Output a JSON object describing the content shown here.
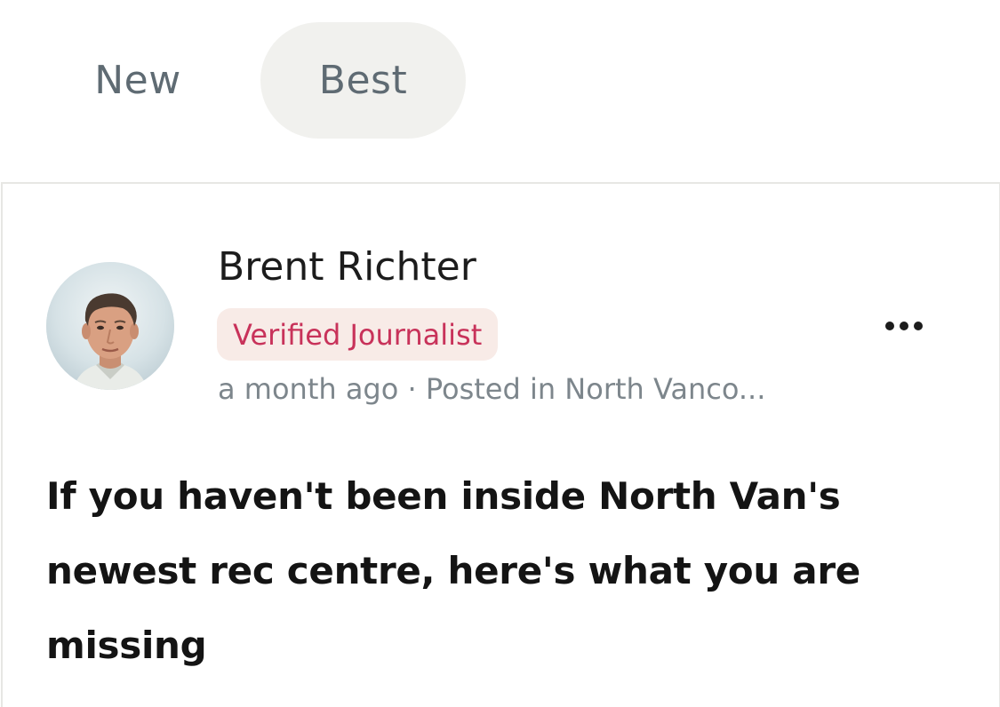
{
  "tabs": {
    "new_label": "New",
    "best_label": "Best",
    "selected": "Best"
  },
  "post": {
    "author_name": "Brent Richter",
    "badge": "Verified Journalist",
    "meta": "a month ago · Posted in North Vanco...",
    "headline": "If you haven't been inside North Van's newest rec centre, here's what you are missing"
  },
  "icons": {
    "avatar": "author-photo",
    "more": "more-options-icon"
  },
  "colors": {
    "tab_selected_bg": "#f1f1ee",
    "tab_text": "#5f6b73",
    "badge_bg": "#f8ebe7",
    "badge_text": "#c8325a",
    "meta_text": "#7d868c",
    "headline_text": "#141414"
  }
}
